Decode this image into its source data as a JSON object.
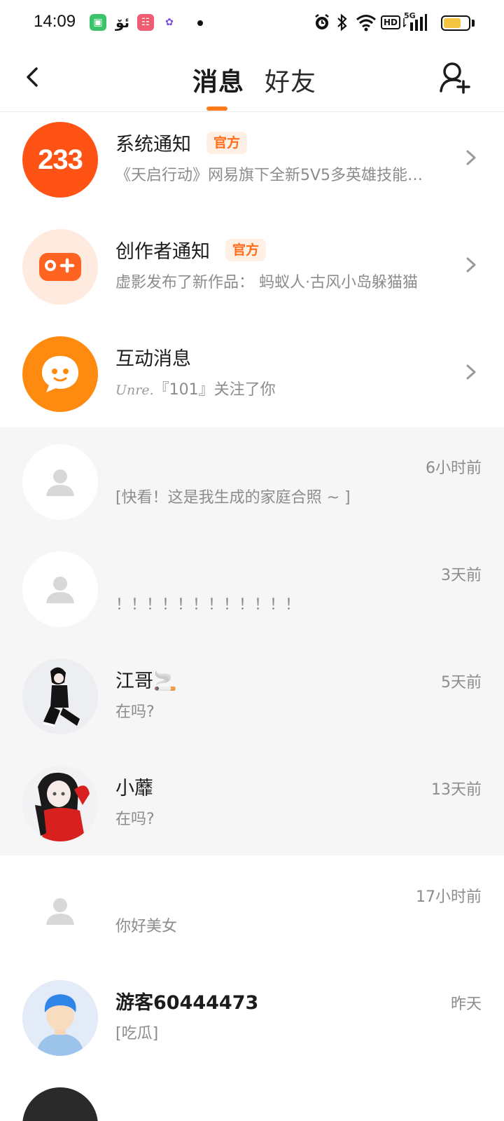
{
  "status_bar": {
    "time": "14:09",
    "network": "5G",
    "hd_label": "HD",
    "battery_level": 0.7
  },
  "header": {
    "tabs": [
      {
        "label": "消息",
        "active": true
      },
      {
        "label": "好友",
        "active": false
      }
    ],
    "accent_color": "#ff7a1a"
  },
  "official_items": [
    {
      "title": "系统通知",
      "badge": "官方",
      "subtitle": "《天启行动》网易旗下全新5V5多英雄技能…",
      "avatar_text": "233",
      "icon": "app-logo-233"
    },
    {
      "title": "创作者通知",
      "badge": "官方",
      "subtitle": "虚影发布了新作品：  蚂蚁人·古风小岛躲猫猫",
      "icon": "gamepad-plus-icon"
    },
    {
      "title": "互动消息",
      "subtitle_name": "Unre.",
      "subtitle": "『101』关注了你",
      "icon": "chat-bubble-face-icon"
    }
  ],
  "conversations": [
    {
      "name": "",
      "time": "6小时前",
      "preview": "[快看！这是我生成的家庭合照 ~ ]",
      "avatar": "default-user-icon",
      "shaded": true
    },
    {
      "name": "",
      "time": "3天前",
      "preview": "！！！！！！！！！！！！",
      "avatar": "default-user-icon",
      "shaded": true
    },
    {
      "name": "江哥🚬",
      "time": "5天前",
      "preview": "在吗?",
      "avatar": "anime-avatar-dark",
      "shaded": true
    },
    {
      "name": "小蘼",
      "time": "13天前",
      "preview": "在吗?",
      "avatar": "anime-avatar-red",
      "shaded": true
    },
    {
      "name": "",
      "time": "17小时前",
      "preview": "你好美女",
      "avatar": "default-user-icon",
      "shaded": false
    },
    {
      "name": "游客60444473",
      "time": "昨天",
      "preview": "[吃瓜]",
      "avatar": "guest-avatar-icon",
      "shaded": false
    }
  ]
}
